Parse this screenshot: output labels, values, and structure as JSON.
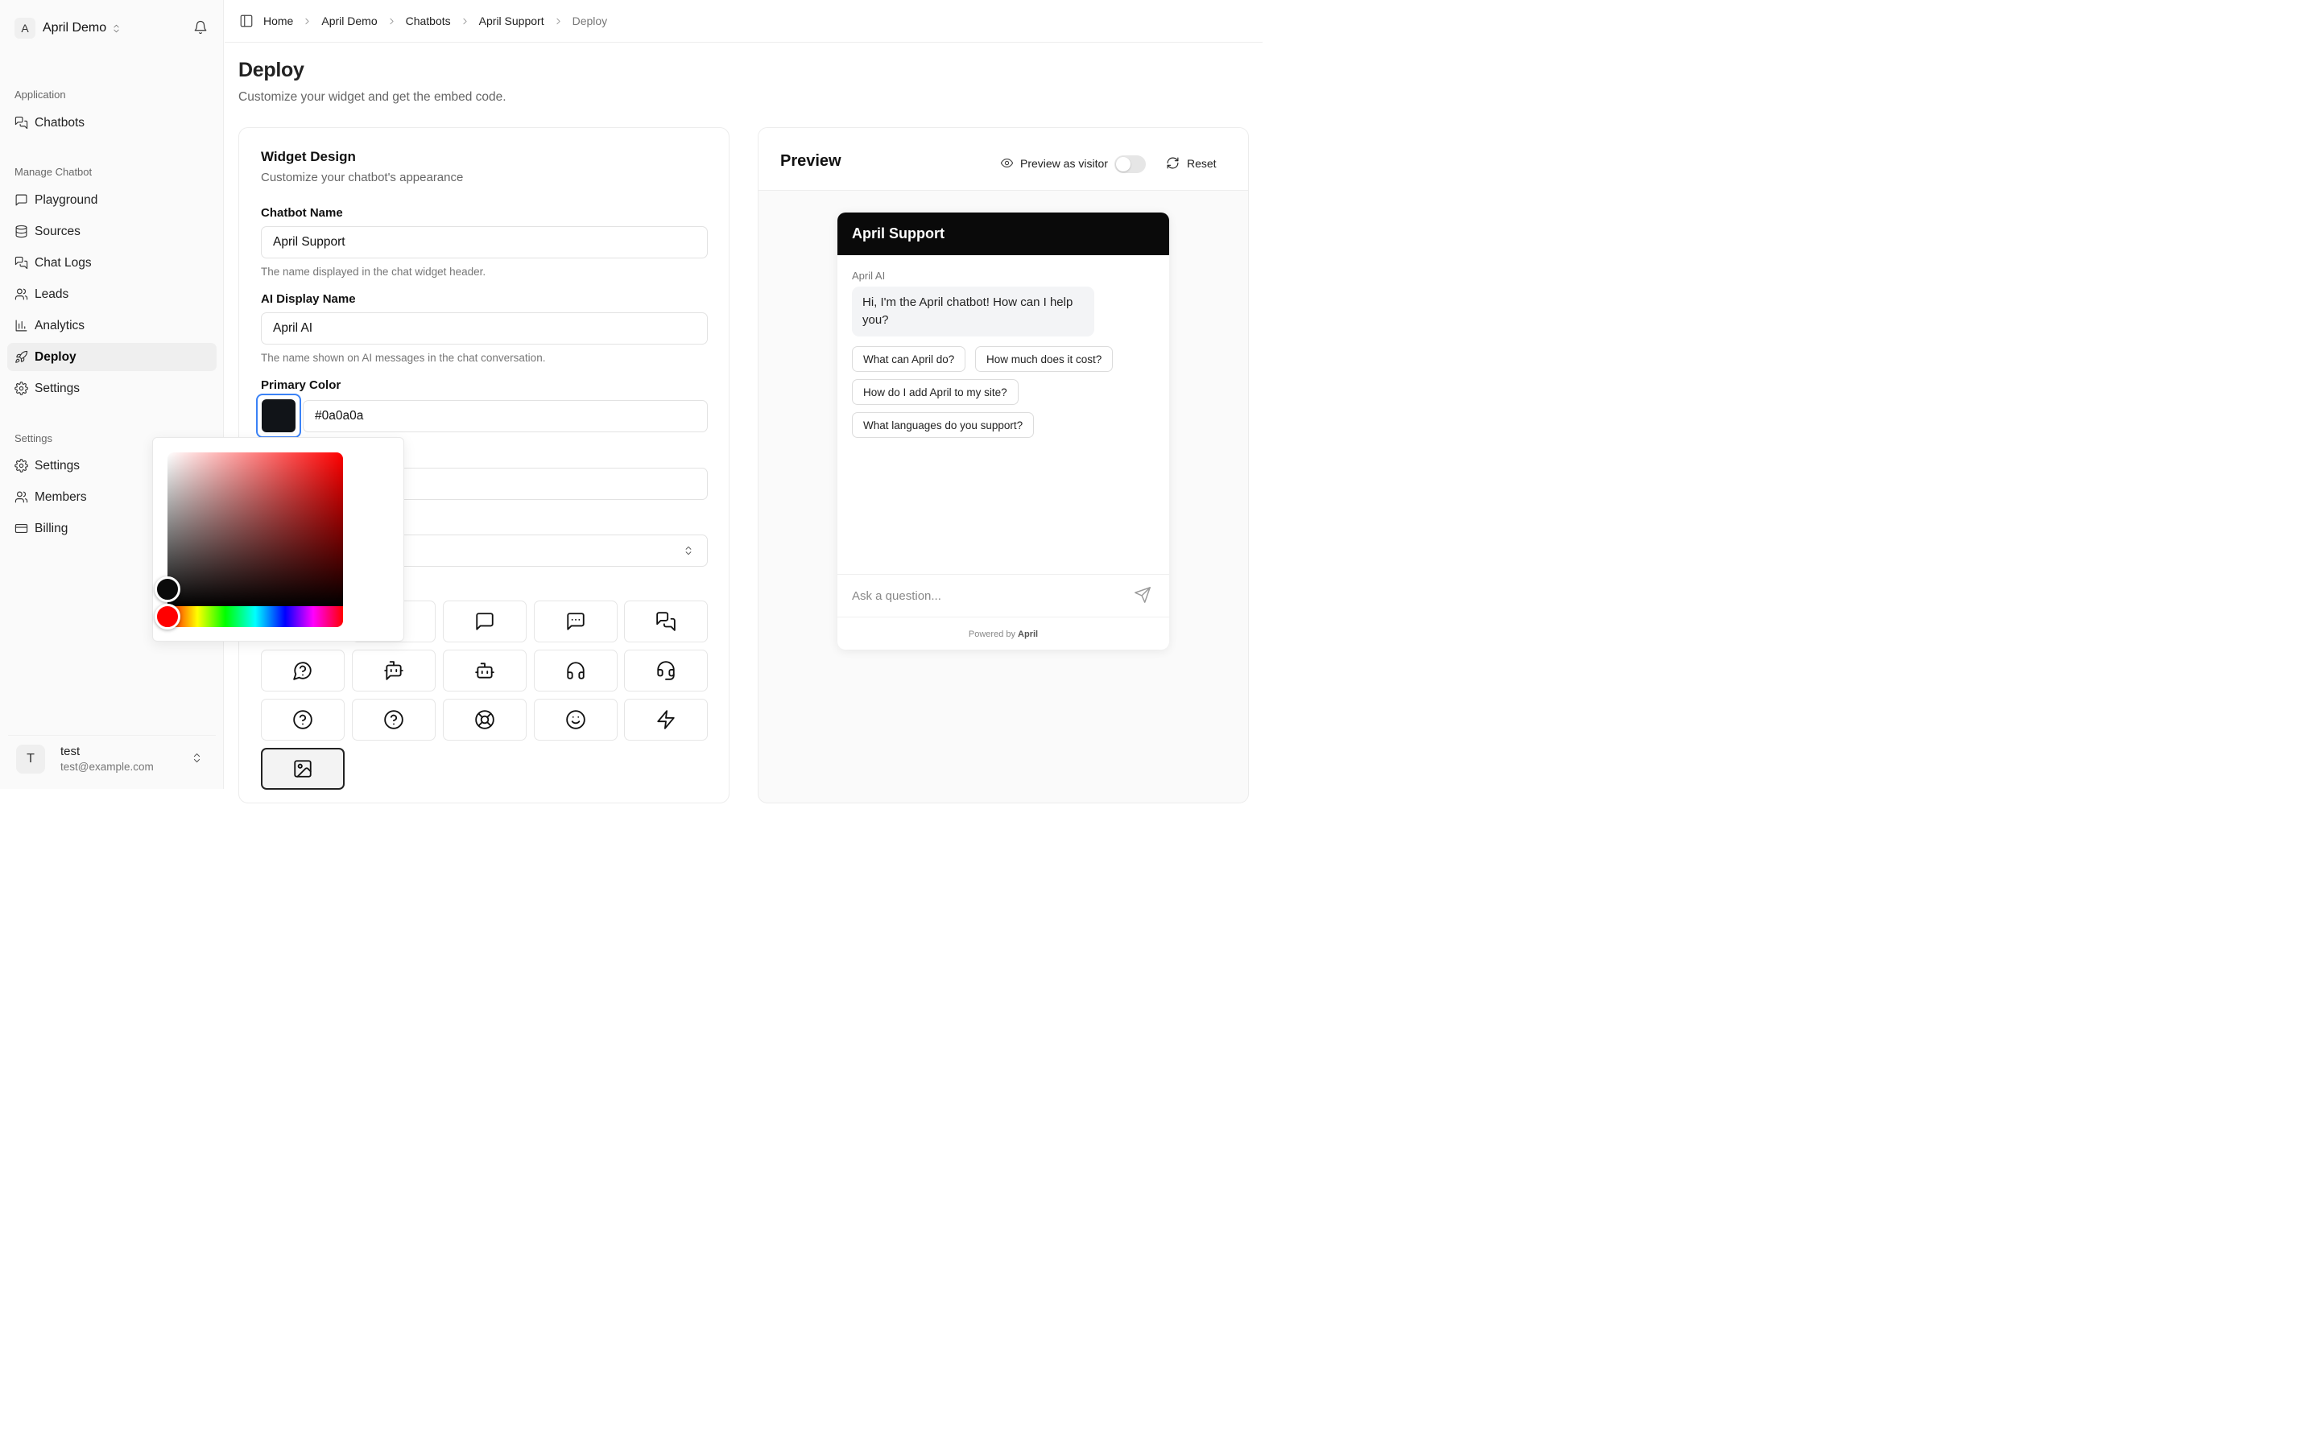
{
  "org": {
    "initial": "A",
    "name": "April Demo"
  },
  "sidebar": {
    "section_application": "Application",
    "section_manage": "Manage Chatbot",
    "section_settings": "Settings",
    "items": {
      "chatbots": "Chatbots",
      "playground": "Playground",
      "sources": "Sources",
      "chat_logs": "Chat Logs",
      "leads": "Leads",
      "analytics": "Analytics",
      "deploy": "Deploy",
      "settings": "Settings",
      "org_settings": "Settings",
      "members": "Members",
      "billing": "Billing"
    },
    "active": "Deploy"
  },
  "user": {
    "initial": "T",
    "name": "test",
    "email": "test@example.com"
  },
  "breadcrumb": [
    "Home",
    "April Demo",
    "Chatbots",
    "April Support",
    "Deploy"
  ],
  "page": {
    "title": "Deploy",
    "subtitle": "Customize your widget and get the embed code."
  },
  "design": {
    "title": "Widget Design",
    "subtitle": "Customize your chatbot's appearance",
    "chatbot_name_label": "Chatbot Name",
    "chatbot_name_value": "April Support",
    "chatbot_name_help": "The name displayed in the chat widget header.",
    "ai_name_label": "AI Display Name",
    "ai_name_value": "April AI",
    "ai_name_help": "The name shown on AI messages in the chat conversation.",
    "primary_color_label": "Primary Color",
    "primary_color_value": "#0a0a0a",
    "swatch_color": "#111418",
    "launcher_icons": [
      "message-square-icon",
      "message-square-icon",
      "message-square-more-icon",
      "messages-square-icon",
      "message-circle-question-icon",
      "bot-message-square-icon",
      "bot-icon",
      "headphones-icon",
      "headset-icon",
      "circle-help-icon",
      "circle-question-mark-icon",
      "life-buoy-icon",
      "smile-icon",
      "zap-icon",
      "image-icon"
    ],
    "selected_icon": "image-icon"
  },
  "color_picker": {
    "hue": "#ff0000",
    "selected": "#0a0a0a"
  },
  "preview": {
    "title": "Preview",
    "visitor_label": "Preview as visitor",
    "visitor_toggle": false,
    "reset_label": "Reset",
    "widget": {
      "header": "April Support",
      "header_color": "#0a0a0a",
      "ai_name": "April AI",
      "greeting": "Hi, I'm the April chatbot! How can I help you?",
      "suggestions": [
        "What can April do?",
        "How much does it cost?",
        "How do I add April to my site?",
        "What languages do you support?"
      ],
      "input_placeholder": "Ask a question...",
      "powered_prefix": "Powered by",
      "powered_brand": "April"
    }
  }
}
